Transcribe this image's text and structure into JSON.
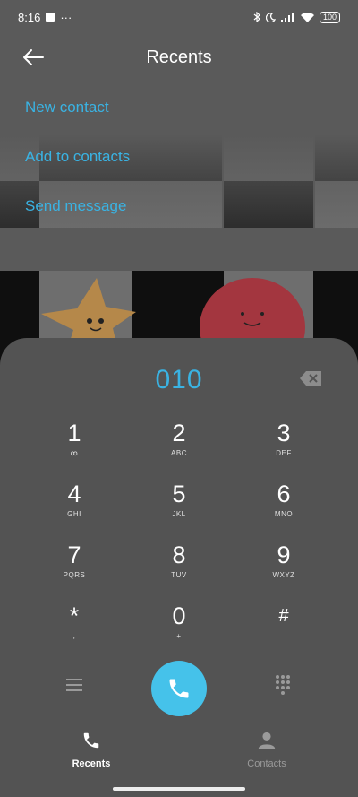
{
  "status_bar": {
    "time": "8:16",
    "dots": "···",
    "battery": "100"
  },
  "header": {
    "title": "Recents",
    "back_icon": "arrow-left-icon"
  },
  "actions": [
    {
      "label": "New contact"
    },
    {
      "label": "Add to contacts"
    },
    {
      "label": "Send message"
    }
  ],
  "dialer": {
    "number": "010",
    "keys": [
      {
        "digit": "1",
        "letters": "ꝏ"
      },
      {
        "digit": "2",
        "letters": "ABC"
      },
      {
        "digit": "3",
        "letters": "DEF"
      },
      {
        "digit": "4",
        "letters": "GHI"
      },
      {
        "digit": "5",
        "letters": "JKL"
      },
      {
        "digit": "6",
        "letters": "MNO"
      },
      {
        "digit": "7",
        "letters": "PQRS"
      },
      {
        "digit": "8",
        "letters": "TUV"
      },
      {
        "digit": "9",
        "letters": "WXYZ"
      },
      {
        "digit": "*",
        "letters": ","
      },
      {
        "digit": "0",
        "letters": "+"
      },
      {
        "digit": "#",
        "letters": ""
      }
    ]
  },
  "nav": {
    "recents_label": "Recents",
    "contacts_label": "Contacts"
  },
  "colors": {
    "accent": "#3ab3e3",
    "call_button": "#45c2ea",
    "background": "#5a5a5a"
  }
}
